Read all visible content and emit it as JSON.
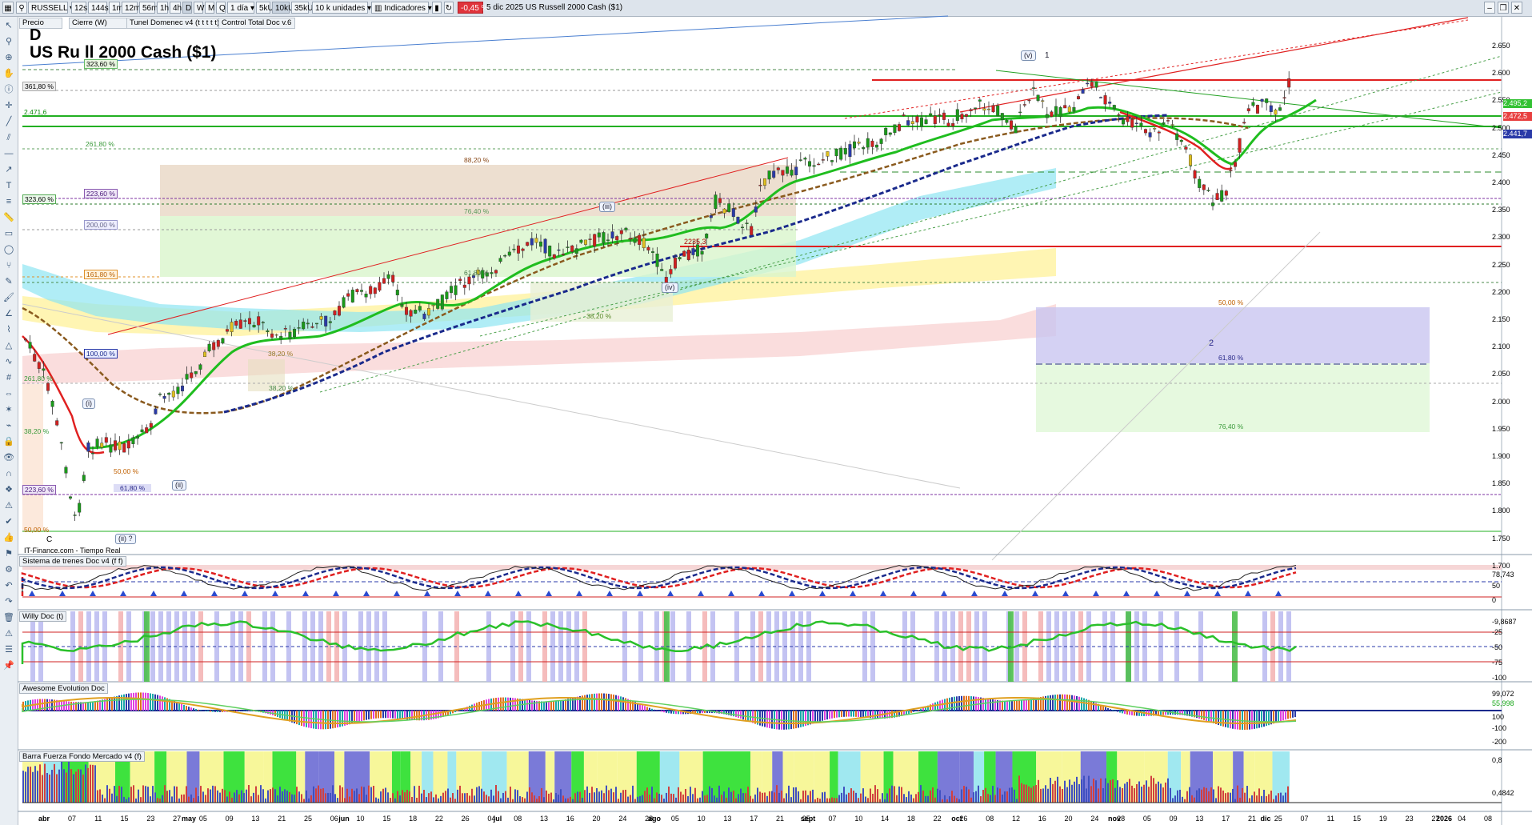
{
  "toolbar": {
    "symbol": "RUSSELL",
    "timeframes": [
      "12s",
      "144s",
      "1m",
      "12m",
      "56m",
      "1h",
      "4h",
      "D",
      "W",
      "M",
      "Q"
    ],
    "volumes": [
      "5kU",
      "10kU",
      "35kU"
    ],
    "period": "1 día",
    "units": "10 k unidades",
    "indicators": "Indicadores",
    "change": "-0,45 %",
    "headline": "5 dic 2025 US Russell 2000 Cash ($1)"
  },
  "tabs": [
    "Precio",
    "Cierre (W)",
    "Tunel Domenec v4 (t t t t t)",
    "Control Total Doc v.6"
  ],
  "chart": {
    "timeframe_label": "D",
    "title": "US Ru      ll 2000 Cash ($1)",
    "source": "IT-Finance.com - Tiempo Real",
    "price_axis": [
      "2.650",
      "2.600",
      "2.550",
      "2.500",
      "2.450",
      "2.400",
      "2.350",
      "2.300",
      "2.250",
      "2.200",
      "2.150",
      "2.100",
      "2.050",
      "2.000",
      "1.950",
      "1.900",
      "1.850",
      "1.800",
      "1.750",
      "1.700"
    ],
    "right_boxes": [
      "2.495,2",
      "2.472,5",
      "2.441,7"
    ],
    "left_boxes": [
      "323,60 %",
      "361,80 %",
      "2.471,6",
      "261,80 %",
      "323,60 %",
      "223,60 %",
      "200,00 %",
      "161,80 %",
      "100,00 %",
      "261,80 %",
      "38,20 %",
      "223,60 %",
      "50,00 %"
    ],
    "fib_labels": [
      "88,20 %",
      "76,40 %",
      "61,80 %",
      "38,20 %",
      "50,00 %",
      "61,80 %",
      "76,40 %",
      "50,00 %",
      "61,80 %",
      "38,20 %",
      "38,20 %"
    ],
    "wave_labels": [
      "(v)",
      "1",
      "(iii)",
      "(iv)",
      "(i)",
      "(ii)",
      "(ii) ?",
      "C",
      "2"
    ],
    "marker": "2235,3"
  },
  "panels": [
    {
      "title": "Sistema de trenes Doc v4 (f f)",
      "axis": [
        "78,743",
        "50",
        "0"
      ]
    },
    {
      "title": "Willy Doc (t)",
      "axis": [
        "-9,8687",
        "-25",
        "-50",
        "-75",
        "-100"
      ]
    },
    {
      "title": "Awesome Evolution Doc",
      "axis": [
        "99,072",
        "55,998",
        "100",
        "-100",
        "-200"
      ]
    },
    {
      "title": "Barra Fuerza Fondo Mercado v4 (f)",
      "axis": [
        "0,8",
        "0,4842"
      ]
    }
  ],
  "x_axis": {
    "months": [
      "abr",
      "may",
      "jun",
      "jul",
      "ago",
      "sept",
      "oct",
      "nov",
      "dic",
      "2026"
    ],
    "days": [
      "07",
      "11",
      "15",
      "23",
      "27",
      "05",
      "09",
      "13",
      "21",
      "25",
      "06",
      "10",
      "15",
      "18",
      "22",
      "26",
      "04",
      "08",
      "13",
      "16",
      "20",
      "24",
      "28",
      "05",
      "10",
      "13",
      "17",
      "21",
      "25",
      "07",
      "10",
      "14",
      "18",
      "22",
      "26",
      "08",
      "12",
      "16",
      "20",
      "24",
      "28",
      "05",
      "09",
      "13",
      "17",
      "21",
      "25",
      "07",
      "11",
      "15",
      "19",
      "23",
      "27",
      "04",
      "08"
    ]
  },
  "colors": {
    "up_red_line": "#e23b3b",
    "support_green": "#1aa81a",
    "ema_green": "#1fbd1f",
    "ema_blue": "#1a2a8c",
    "brown_ma": "#8a5a1e",
    "zone_cyan": "#8ee9f3",
    "zone_yellow": "#fff4a8",
    "zone_pink": "#f6c6c6",
    "zone_lavender": "#c9c6f0",
    "zone_mint": "#d6f3c9"
  }
}
